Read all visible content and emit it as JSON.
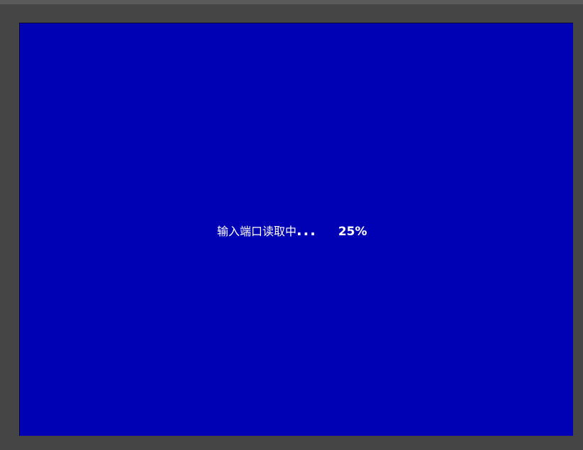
{
  "screen": {
    "background_color": "#0000b4",
    "frame_color": "#454545",
    "status": {
      "text": "输入端口读取中",
      "ellipsis": "...",
      "progress_text": "25%",
      "progress_value": 25
    }
  }
}
